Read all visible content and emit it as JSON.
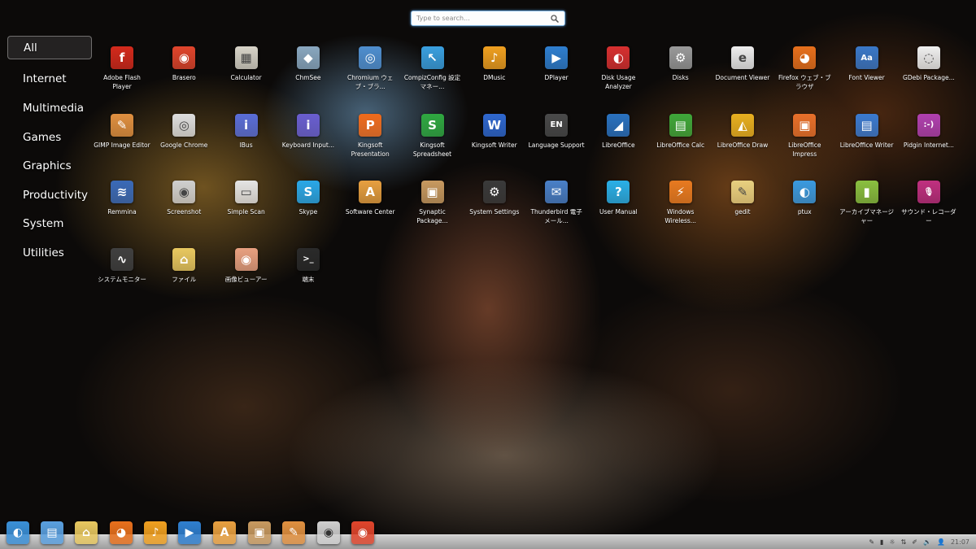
{
  "search": {
    "placeholder": "Type to search..."
  },
  "categories": [
    "All",
    "Internet",
    "Multimedia",
    "Games",
    "Graphics",
    "Productivity",
    "System",
    "Utilities"
  ],
  "apps": [
    {
      "label": "Adobe Flash Player",
      "glyph": "f",
      "color": "#d42a1c",
      "icon": "flash-player-icon"
    },
    {
      "label": "Brasero",
      "glyph": "◉",
      "color": "#e0452c",
      "icon": "brasero-disc-icon"
    },
    {
      "label": "Calculator",
      "glyph": "▦",
      "color": "#d8d4c8",
      "icon": "calculator-icon"
    },
    {
      "label": "ChmSee",
      "glyph": "◆",
      "color": "#8aa8c0",
      "icon": "chmsee-icon"
    },
    {
      "label": "Chromium ウェブ・ブラ...",
      "glyph": "◎",
      "color": "#4f8fd0",
      "icon": "chromium-icon"
    },
    {
      "label": "CompizConfig 設定マネー...",
      "glyph": "↖",
      "color": "#3aa0e0",
      "icon": "compizconfig-icon"
    },
    {
      "label": "DMusic",
      "glyph": "♪",
      "color": "#f0a020",
      "icon": "dmusic-icon"
    },
    {
      "label": "DPlayer",
      "glyph": "▶",
      "color": "#2f7fd0",
      "icon": "dplayer-icon"
    },
    {
      "label": "Disk Usage Analyzer",
      "glyph": "◐",
      "color": "#d83030",
      "icon": "disk-usage-icon"
    },
    {
      "label": "Disks",
      "glyph": "⚙",
      "color": "#9a9a9a",
      "icon": "disks-icon"
    },
    {
      "label": "Document Viewer",
      "glyph": "e",
      "color": "#eeeeee",
      "icon": "document-viewer-icon"
    },
    {
      "label": "Firefox ウェブ・ブラウザ",
      "glyph": "◕",
      "color": "#e8701c",
      "icon": "firefox-icon"
    },
    {
      "label": "Font Viewer",
      "glyph": "Aa",
      "color": "#3a78c8",
      "icon": "font-viewer-icon"
    },
    {
      "label": "GDebi Package...",
      "glyph": "◌",
      "color": "#f0f0f0",
      "icon": "gdebi-icon"
    },
    {
      "label": "GIMP Image Editor",
      "glyph": "✎",
      "color": "#e09040",
      "icon": "gimp-icon"
    },
    {
      "label": "Google Chrome",
      "glyph": "◎",
      "color": "#dedede",
      "icon": "chrome-icon"
    },
    {
      "label": "IBus",
      "glyph": "i",
      "color": "#5a6ed8",
      "icon": "ibus-icon"
    },
    {
      "label": "Keyboard Input...",
      "glyph": "i",
      "color": "#6a5ed0",
      "icon": "keyboard-input-icon"
    },
    {
      "label": "Kingsoft Presentation",
      "glyph": "P",
      "color": "#f06a1a",
      "icon": "kingsoft-presentation-icon"
    },
    {
      "label": "Kingsoft Spreadsheet",
      "glyph": "S",
      "color": "#2fa840",
      "icon": "kingsoft-spreadsheet-icon"
    },
    {
      "label": "Kingsoft Writer",
      "glyph": "W",
      "color": "#2f68d0",
      "icon": "kingsoft-writer-icon"
    },
    {
      "label": "Language Support",
      "glyph": "EN",
      "color": "#4a4a4a",
      "icon": "language-support-icon"
    },
    {
      "label": "LibreOffice",
      "glyph": "◢",
      "color": "#2a72c0",
      "icon": "libreoffice-icon"
    },
    {
      "label": "LibreOffice Calc",
      "glyph": "▤",
      "color": "#3fa83a",
      "icon": "libreoffice-calc-icon"
    },
    {
      "label": "LibreOffice Draw",
      "glyph": "◭",
      "color": "#e8b020",
      "icon": "libreoffice-draw-icon"
    },
    {
      "label": "LibreOffice Impress",
      "glyph": "▣",
      "color": "#e8702a",
      "icon": "libreoffice-impress-icon"
    },
    {
      "label": "LibreOffice Writer",
      "glyph": "▤",
      "color": "#3a7ad0",
      "icon": "libreoffice-writer-icon"
    },
    {
      "label": "Pidgin Internet...",
      "glyph": ":-)",
      "color": "#b040b0",
      "icon": "pidgin-icon"
    },
    {
      "label": "Remmina",
      "glyph": "≋",
      "color": "#3a6ab8",
      "icon": "remmina-icon"
    },
    {
      "label": "Screenshot",
      "glyph": "◉",
      "color": "#cfcfcf",
      "icon": "screenshot-icon"
    },
    {
      "label": "Simple Scan",
      "glyph": "▭",
      "color": "#e4e4e4",
      "icon": "simple-scan-icon"
    },
    {
      "label": "Skype",
      "glyph": "S",
      "color": "#2aa8e8",
      "icon": "skype-icon"
    },
    {
      "label": "Software Center",
      "glyph": "A",
      "color": "#e8a040",
      "icon": "software-center-icon"
    },
    {
      "label": "Synaptic Package...",
      "glyph": "▣",
      "color": "#c89a60",
      "icon": "synaptic-icon"
    },
    {
      "label": "System Settings",
      "glyph": "⚙",
      "color": "#3a3a3a",
      "icon": "system-settings-icon"
    },
    {
      "label": "Thunderbird 電子メール...",
      "glyph": "✉",
      "color": "#4a80c8",
      "icon": "thunderbird-icon"
    },
    {
      "label": "User Manual",
      "glyph": "?",
      "color": "#2ab0e8",
      "icon": "user-manual-icon"
    },
    {
      "label": "Windows Wireless...",
      "glyph": "⚡",
      "color": "#e87a20",
      "icon": "windows-wireless-icon"
    },
    {
      "label": "gedit",
      "glyph": "✎",
      "color": "#e8d080",
      "icon": "gedit-icon"
    },
    {
      "label": "ptux",
      "glyph": "◐",
      "color": "#3a9ae0",
      "icon": "ptux-icon"
    },
    {
      "label": "アーカイブマネージャー",
      "glyph": "▮",
      "color": "#8ac040",
      "icon": "archive-manager-icon"
    },
    {
      "label": "サウンド・レコーダー",
      "glyph": "🎙",
      "color": "#c03080",
      "icon": "sound-recorder-icon"
    },
    {
      "label": "システムモニター",
      "glyph": "∿",
      "color": "#404040",
      "icon": "system-monitor-icon"
    },
    {
      "label": "ファイル",
      "glyph": "⌂",
      "color": "#e8c860",
      "icon": "files-icon"
    },
    {
      "label": "画像ビューアー",
      "glyph": "◉",
      "color": "#e8a080",
      "icon": "image-viewer-icon"
    },
    {
      "label": "端末",
      "glyph": ">_",
      "color": "#2a2a2a",
      "icon": "terminal-icon"
    }
  ],
  "dock": [
    {
      "name": "launcher-icon",
      "glyph": "◐",
      "color": "#3a90d8"
    },
    {
      "name": "keyboard-icon",
      "glyph": "▤",
      "color": "#5aa0e0"
    },
    {
      "name": "files-icon",
      "glyph": "⌂",
      "color": "#e8c860"
    },
    {
      "name": "firefox-icon",
      "glyph": "◕",
      "color": "#e8701c"
    },
    {
      "name": "dmusic-icon",
      "glyph": "♪",
      "color": "#f0a020"
    },
    {
      "name": "dplayer-icon",
      "glyph": "▶",
      "color": "#2f7fd0"
    },
    {
      "name": "software-center-icon",
      "glyph": "A",
      "color": "#e8a040"
    },
    {
      "name": "synaptic-icon",
      "glyph": "▣",
      "color": "#c89a60"
    },
    {
      "name": "gimp-icon",
      "glyph": "✎",
      "color": "#e09040"
    },
    {
      "name": "screenshot-icon",
      "glyph": "◉",
      "color": "#cfcfcf"
    },
    {
      "name": "brasero-disc-icon",
      "glyph": "◉",
      "color": "#e0452c"
    }
  ],
  "tray": {
    "icons": [
      "notification-icon",
      "battery-icon",
      "lightbulb-icon",
      "network-icon",
      "pen-icon",
      "volume-icon",
      "user-icon"
    ],
    "glyphs": [
      "✎",
      "▮",
      "☼",
      "⇅",
      "✐",
      "🔊",
      "👤"
    ],
    "clock": "21:07"
  }
}
